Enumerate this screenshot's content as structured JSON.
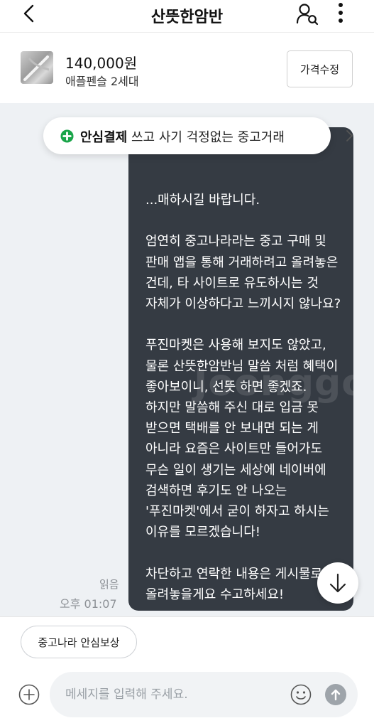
{
  "header": {
    "title": "산뜻한암반",
    "back_icon": "chevron-left-icon",
    "user_search_icon": "user-search-icon",
    "more_icon": "more-vertical-icon"
  },
  "product": {
    "price": "140,000원",
    "name": "애플펜슬 2세대",
    "edit_price_label": "가격수정"
  },
  "safe_payment_banner": {
    "bold": "안심결제",
    "rest": "쓰고 사기 걱정없는 중고거래",
    "chevron": "›",
    "accent_color": "#1aa54a"
  },
  "message": {
    "text": "...매하시길 바랍니다.\n\n엄연히 중고나라라는 중고 구매 및 판매 앱을 통해 거래하려고 올려놓은 건데, 타 사이트로 유도하시는 것 자체가 이상하다고 느끼시지 않나요?\n\n푸진마켓은 사용해 보지도 않았고, 물론 산뜻한암반님 말씀 처럼 혜택이 좋아보이니, 선뜻 하면 좋겠죠.\n하지만 말씀해 주신 대로 입금 못 받으면 택배를 안 보내면 되는 게 아니라 요즘은 사이트만 들어가도 무슨 일이 생기는 세상에 네이버에 검색하면 후기도 안 나오는 '푸진마켓'에서 굳이 하자고 하시는 이유를 모르겠습니다!\n\n차단하고 연락한 내용은 게시물로 올려놓을게요 수고하세요!",
    "read_status": "읽음",
    "time": "오후 01:07",
    "watermark": "Joonggonara",
    "bubble_color": "#353b43"
  },
  "bottom": {
    "chip_label": "중고나라 안심보상",
    "input_placeholder": "메세지를 입력해 주세요.",
    "add_icon": "plus-circle-icon",
    "emoji_icon": "smile-icon",
    "send_icon": "arrow-up-icon"
  }
}
